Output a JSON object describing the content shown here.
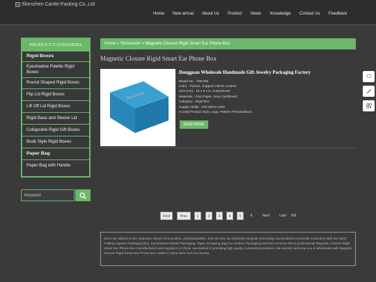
{
  "header": {
    "logo_alt": "Shenzhen Canfei Packing Co.,Ltd",
    "nav": [
      "Home",
      "New arrival",
      "About Us",
      "Product",
      "News",
      "Knowledge",
      "Contact Us",
      "Feedback"
    ]
  },
  "sidebar": {
    "title": "PRODUCT CATEGORIES",
    "items": [
      {
        "label": "Rigid Boxes"
      },
      {
        "label": "Eyeshadow Palette Rigid Boxes"
      },
      {
        "label": "Round Shaped Rigid Boxes"
      },
      {
        "label": "Flip Lid Rigid Boxes"
      },
      {
        "label": "Lift Off Lid Rigid Boxes"
      },
      {
        "label": "Rigid Base and Sleeve Lid"
      },
      {
        "label": "Collapsible Rigid Gift Boxes"
      },
      {
        "label": "Book Style Rigid Boxes"
      },
      {
        "label": "Paper Bag"
      },
      {
        "label": "Paper Bag with Handle"
      }
    ],
    "search_placeholder": "Keyword"
  },
  "main": {
    "breadcrumb": "Home > Showroom > Magnetic Closure Rigid Smart Ear Phone Box",
    "title": "Magnetic Closure Rigid Smart Ear Phone Box",
    "product": {
      "name": "Dongguan Wholesale Handmade Gift Jewelry Packaging Factory",
      "specs": [
        "Model No. : RB-005",
        "Color : Picture, Support CMYK Custom",
        "Size (cm) : 18 x 6 x 6, Customized",
        "Materials : Fine Paper, Grey Cardboard",
        "Category : Rigid Box",
        "Supply Ability : 200,000,0 Units",
        "Accept Product Size, Logo, Pattern Personalized..."
      ],
      "read_more": "READ MORE",
      "image_text": "Dua Gosha"
    },
    "pagination": [
      "First",
      "Prev",
      "1",
      "2",
      "3",
      "4",
      "5",
      "6",
      "Next",
      "Last",
      "6/6"
    ],
    "about": "Since we adhere to the corporate values of innovation, professionalism, and win-win, we perfectly integrate technology and products to provide customers with the latest Folding Apparel Packaging Box, Eyeshadow Palette Packaging, Paper Shopping Bag For Clothes Packaging and best services.We're professional Magnetic Closure Rigid Smart Ear-Phone Box manufacturers and suppliers in China, specialized in providing high quality customized products. We warmly welcome you to wholesale bulk Magnetic Closure Rigid Smart Ear-Phone Box made in China here from our factory."
  },
  "colors": {
    "accent": "#6bb86b",
    "background": "#3a3a3a",
    "header": "#2d2d2d"
  }
}
